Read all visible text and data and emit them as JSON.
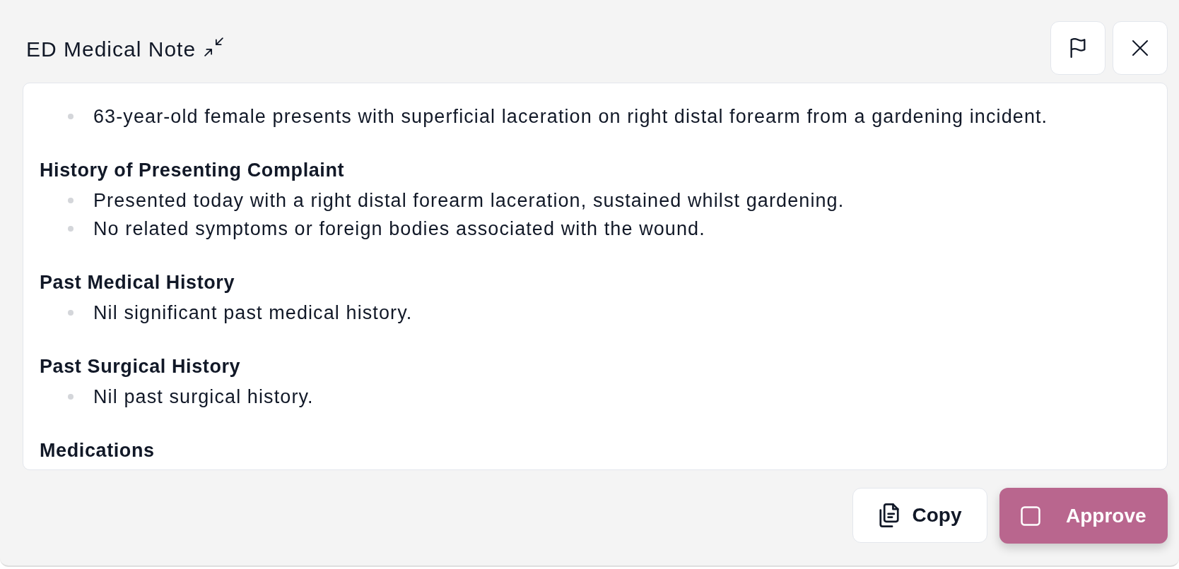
{
  "title": "ED Medical Note",
  "note": {
    "sections": [
      {
        "items": [
          "63-year-old female presents with superficial laceration on right distal forearm from a gardening incident."
        ]
      },
      {
        "heading": "History of Presenting Complaint",
        "items": [
          "Presented today with a right distal forearm laceration, sustained whilst gardening.",
          "No related symptoms or foreign bodies associated with the wound."
        ]
      },
      {
        "heading": "Past Medical History",
        "items": [
          "Nil significant past medical history."
        ]
      },
      {
        "heading": "Past Surgical History",
        "items": [
          "Nil past surgical history."
        ]
      },
      {
        "heading": "Medications"
      }
    ]
  },
  "actions": {
    "copy": {
      "label": "Copy"
    },
    "approve": {
      "label": "Approve",
      "checked": false
    }
  }
}
